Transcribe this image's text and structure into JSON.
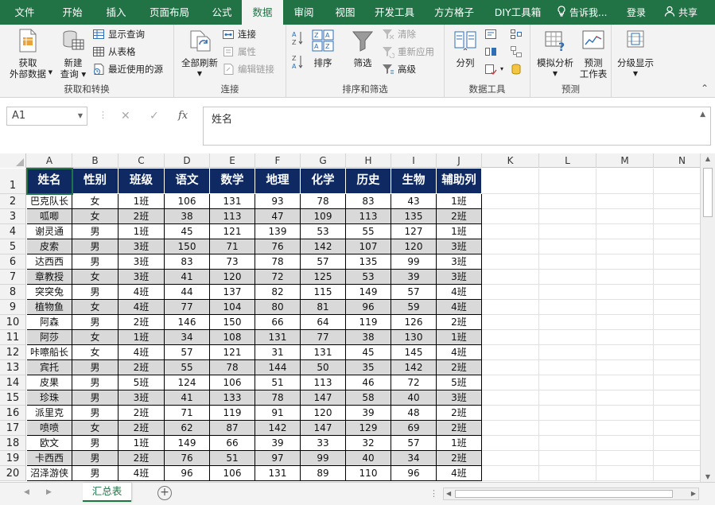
{
  "tabs": {
    "file": "文件",
    "home": "开始",
    "insert": "插入",
    "layout": "页面布局",
    "formulas": "公式",
    "data": "数据",
    "review": "审阅",
    "view": "视图",
    "developer": "开发工具",
    "ffgz": "方方格子",
    "diy": "DIY工具箱",
    "tellme": "告诉我...",
    "login": "登录",
    "share": "共享"
  },
  "ribbon": {
    "get_external": {
      "line1": "获取",
      "line2": "外部数据"
    },
    "new_query": {
      "line1": "新建",
      "line2": "查询"
    },
    "show_queries": "显示查询",
    "from_table": "从表格",
    "recent_sources": "最近使用的源",
    "group_transform": "获取和转换",
    "refresh_all": "全部刷新",
    "connections": "连接",
    "properties": "属性",
    "edit_links": "编辑链接",
    "group_connections": "连接",
    "sort": "排序",
    "filter": "筛选",
    "clear": "清除",
    "reapply": "重新应用",
    "advanced": "高级",
    "group_sortfilter": "排序和筛选",
    "split": "分列",
    "group_datatools": "数据工具",
    "whatif": "模拟分析",
    "forecast_sheet": {
      "line1": "预测",
      "line2": "工作表"
    },
    "group_forecast": "预测",
    "outline": "分级显示"
  },
  "formula_bar": {
    "namebox": "A1",
    "cancel": "✕",
    "enter": "✓",
    "fx": "fx",
    "content": "姓名"
  },
  "columns": [
    "A",
    "B",
    "C",
    "D",
    "E",
    "F",
    "G",
    "H",
    "I",
    "J",
    "K",
    "L",
    "M",
    "N"
  ],
  "table": {
    "headers": [
      "姓名",
      "性别",
      "班级",
      "语文",
      "数学",
      "地理",
      "化学",
      "历史",
      "生物",
      "辅助列"
    ],
    "rows": [
      [
        "巴克队长",
        "女",
        "1班",
        "106",
        "131",
        "93",
        "78",
        "83",
        "43",
        "1班"
      ],
      [
        "呱唧",
        "女",
        "2班",
        "38",
        "113",
        "47",
        "109",
        "113",
        "135",
        "2班"
      ],
      [
        "谢灵通",
        "男",
        "1班",
        "45",
        "121",
        "139",
        "53",
        "55",
        "127",
        "1班"
      ],
      [
        "皮索",
        "男",
        "3班",
        "150",
        "71",
        "76",
        "142",
        "107",
        "120",
        "3班"
      ],
      [
        "达西西",
        "男",
        "3班",
        "83",
        "73",
        "78",
        "57",
        "135",
        "99",
        "3班"
      ],
      [
        "章教授",
        "女",
        "3班",
        "41",
        "120",
        "72",
        "125",
        "53",
        "39",
        "3班"
      ],
      [
        "突突兔",
        "男",
        "4班",
        "44",
        "137",
        "82",
        "115",
        "149",
        "57",
        "4班"
      ],
      [
        "植物鱼",
        "女",
        "4班",
        "77",
        "104",
        "80",
        "81",
        "96",
        "59",
        "4班"
      ],
      [
        "阿森",
        "男",
        "2班",
        "146",
        "150",
        "66",
        "64",
        "119",
        "126",
        "2班"
      ],
      [
        "阿莎",
        "女",
        "1班",
        "34",
        "108",
        "131",
        "77",
        "38",
        "130",
        "1班"
      ],
      [
        "咔嚓船长",
        "女",
        "4班",
        "57",
        "121",
        "31",
        "131",
        "45",
        "145",
        "4班"
      ],
      [
        "宾托",
        "男",
        "2班",
        "55",
        "78",
        "144",
        "50",
        "35",
        "142",
        "2班"
      ],
      [
        "皮果",
        "男",
        "5班",
        "124",
        "106",
        "51",
        "113",
        "46",
        "72",
        "5班"
      ],
      [
        "珍珠",
        "男",
        "3班",
        "41",
        "133",
        "78",
        "147",
        "58",
        "40",
        "3班"
      ],
      [
        "派里克",
        "男",
        "2班",
        "71",
        "119",
        "91",
        "120",
        "39",
        "48",
        "2班"
      ],
      [
        "喷喷",
        "女",
        "2班",
        "62",
        "87",
        "142",
        "147",
        "129",
        "69",
        "2班"
      ],
      [
        "欧文",
        "男",
        "1班",
        "149",
        "66",
        "39",
        "33",
        "32",
        "57",
        "1班"
      ],
      [
        "卡西西",
        "男",
        "2班",
        "76",
        "51",
        "97",
        "99",
        "40",
        "34",
        "2班"
      ],
      [
        "沼泽游侠",
        "男",
        "4班",
        "96",
        "106",
        "131",
        "89",
        "110",
        "96",
        "4班"
      ]
    ]
  },
  "row_numbers": [
    "1",
    "2",
    "3",
    "4",
    "5",
    "6",
    "7",
    "8",
    "9",
    "10",
    "11",
    "12",
    "13",
    "14",
    "15",
    "16",
    "17",
    "18",
    "19",
    "20"
  ],
  "sheet": {
    "name": "汇总表",
    "add": "+",
    "dots": "⋮"
  },
  "colors": {
    "accent": "#217346",
    "table_header": "#0f2a62",
    "alt_row": "#d9d9d9"
  }
}
